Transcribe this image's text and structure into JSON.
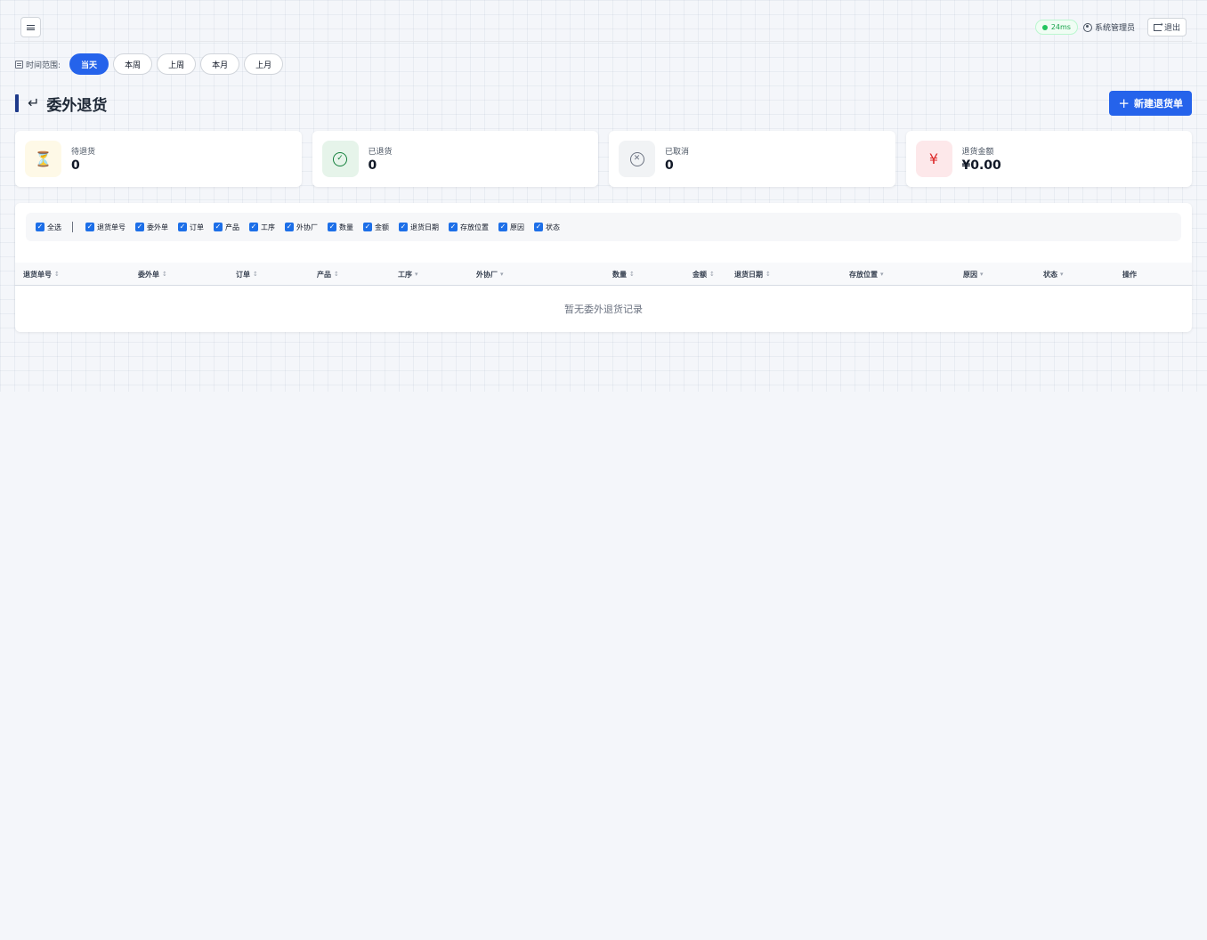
{
  "topbar": {
    "latency": "24ms",
    "user": "系统管理员",
    "logout_label": "退出"
  },
  "range": {
    "label": "时间范围:",
    "options": [
      "当天",
      "本周",
      "上周",
      "本月",
      "上月"
    ],
    "selected": "当天"
  },
  "page": {
    "title": "委外退货",
    "new_button": "新建退货单"
  },
  "stats": [
    {
      "label": "待退货",
      "value": "0",
      "icon": "hourglass-icon"
    },
    {
      "label": "已退货",
      "value": "0",
      "icon": "check-circle-icon"
    },
    {
      "label": "已取消",
      "value": "0",
      "icon": "x-circle-icon"
    },
    {
      "label": "退货金额",
      "value": "¥0.00",
      "icon": "yen-icon"
    }
  ],
  "column_toggles": {
    "select_all": "全选",
    "columns": [
      "退货单号",
      "委外单",
      "订单",
      "产品",
      "工序",
      "外协厂",
      "数量",
      "金额",
      "退货日期",
      "存放位置",
      "原因",
      "状态"
    ]
  },
  "table": {
    "headers": [
      "退货单号",
      "委外单",
      "订单",
      "产品",
      "工序",
      "外协厂",
      "数量",
      "金额",
      "退货日期",
      "存放位置",
      "原因",
      "状态",
      "操作"
    ],
    "empty_text": "暂无委外退货记录"
  },
  "colors": {
    "accent": "#2563eb",
    "background": "#f4f6fa"
  }
}
